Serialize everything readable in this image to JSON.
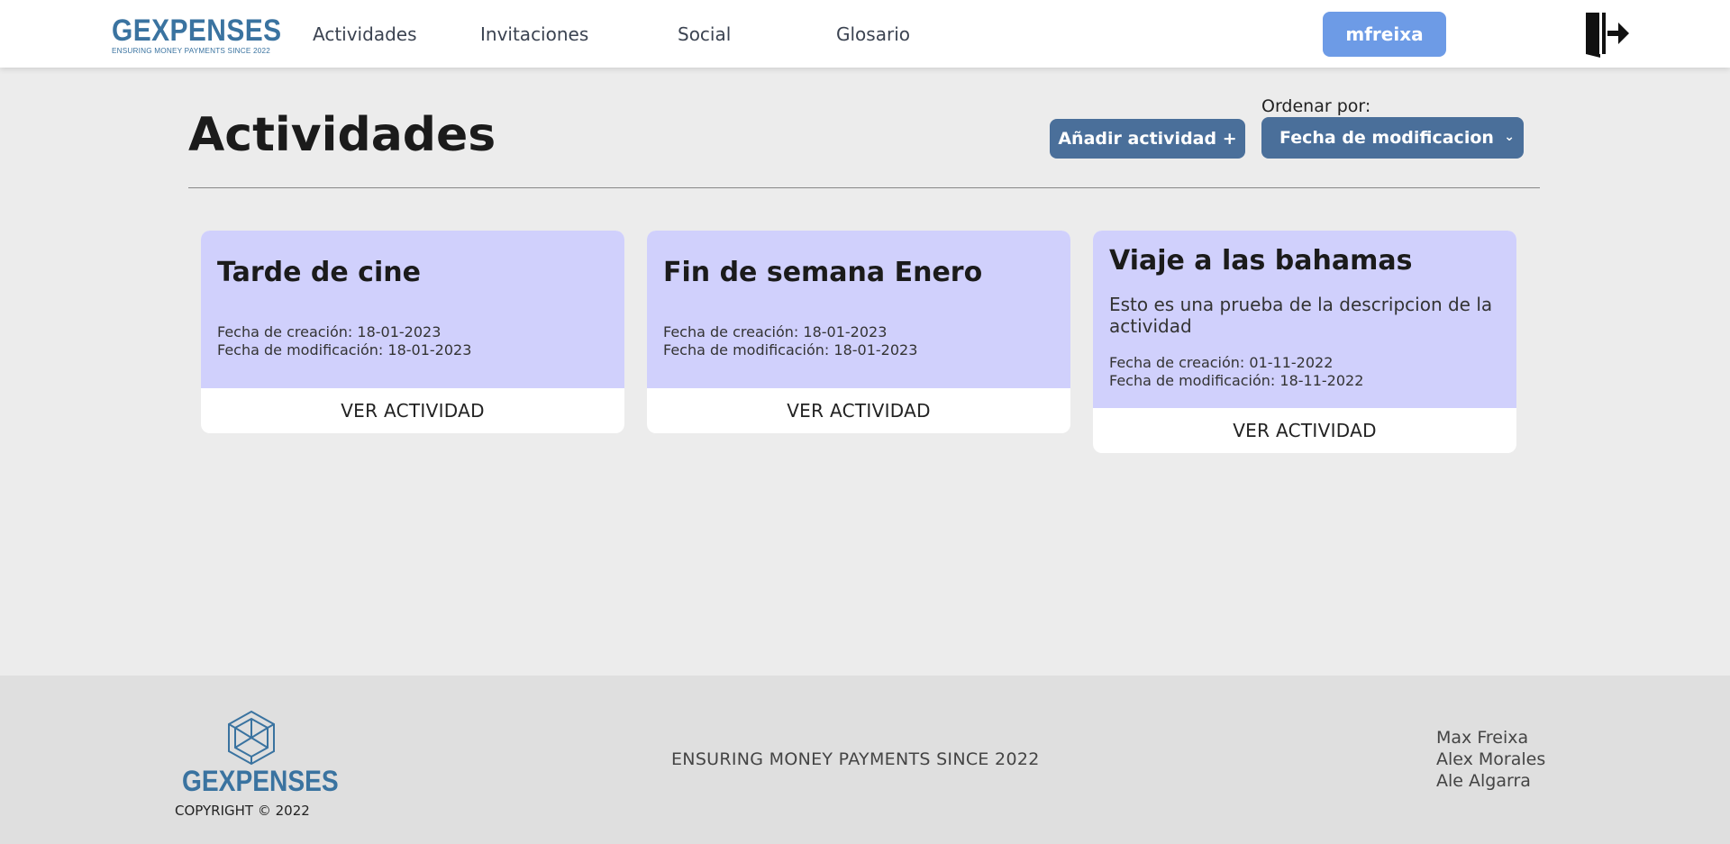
{
  "header": {
    "logo_word": "GEXPENSES",
    "logo_tagline": "ENSURING MONEY PAYMENTS SINCE 2022",
    "nav": [
      {
        "label": "Actividades"
      },
      {
        "label": "Invitaciones"
      },
      {
        "label": "Social"
      },
      {
        "label": "Glosario"
      }
    ],
    "username": "mfreixa",
    "logout_icon": "logout-icon"
  },
  "main": {
    "title": "Actividades",
    "add_button": "Añadir actividad +",
    "sort_label": "Ordenar por:",
    "sort_selected": "Fecha de modificacion",
    "cards": [
      {
        "title": "Tarde de cine",
        "description": "",
        "created": "Fecha de creación: 18-01-2023",
        "modified": "Fecha de modificación: 18-01-2023",
        "action": "VER ACTIVIDAD"
      },
      {
        "title": "Fin de semana Enero",
        "description": "",
        "created": "Fecha de creación: 18-01-2023",
        "modified": "Fecha de modificación: 18-01-2023",
        "action": "VER ACTIVIDAD"
      },
      {
        "title": "Viaje a las bahamas",
        "description": "Esto es una prueba de la descripcion de la actividad",
        "created": "Fecha de creación: 01-11-2022",
        "modified": "Fecha de modificación: 18-11-2022",
        "action": "VER ACTIVIDAD"
      }
    ]
  },
  "footer": {
    "logo_word": "GEXPENSES",
    "copyright": "COPYRIGHT © 2022",
    "tagline": "ENSURING MONEY PAYMENTS SINCE 2022",
    "authors": [
      "Max Freixa",
      "Alex Morales",
      "Ale Algarra"
    ]
  },
  "colors": {
    "brand": "#3a73a0",
    "user_button": "#6d9be6",
    "action_button": "#4a6f9a",
    "card_bg": "#d0d0fc",
    "page_bg": "#ececec",
    "footer_bg": "#dfdfdf"
  }
}
